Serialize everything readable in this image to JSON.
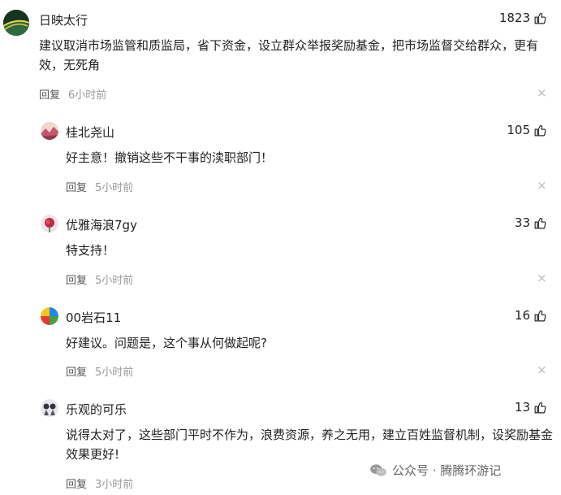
{
  "comments": [
    {
      "user": "日映太行",
      "likes": "1823",
      "text": "建议取消市场监管和质监局，省下资金，设立群众举报奖励基金，把市场监督交给群众，更有效，无死角",
      "reply_label": "回复",
      "time": "6小时前",
      "close_glyph": "×"
    },
    {
      "user": "桂北尧山",
      "likes": "105",
      "text": "好主意！撤销这些不干事的渎职部门！",
      "reply_label": "回复",
      "time": "5小时前",
      "close_glyph": "×"
    },
    {
      "user": "优雅海浪7gy",
      "likes": "33",
      "text": "特支持！",
      "reply_label": "回复",
      "time": "5小时前",
      "close_glyph": "×"
    },
    {
      "user": "00岩石11",
      "likes": "16",
      "text": "好建议。问题是，这个事从何做起呢?",
      "reply_label": "回复",
      "time": "5小时前",
      "close_glyph": "×"
    },
    {
      "user": "乐观的可乐",
      "likes": "13",
      "text": "说得太对了，这些部门平时不作为，浪费资源，养之无用，建立百姓监督机制，设奖励基金效果更好!",
      "reply_label": "回复",
      "time": "3小时前",
      "close_glyph": "×"
    }
  ],
  "watermark": {
    "text": "公众号 · 腾腾环游记"
  },
  "icons": {
    "like": "thumbs-up-icon",
    "close": "close-icon",
    "wechat": "wechat-icon"
  },
  "colors": {
    "text": "#222222",
    "meta": "#999999",
    "close": "#bbbbbb"
  }
}
